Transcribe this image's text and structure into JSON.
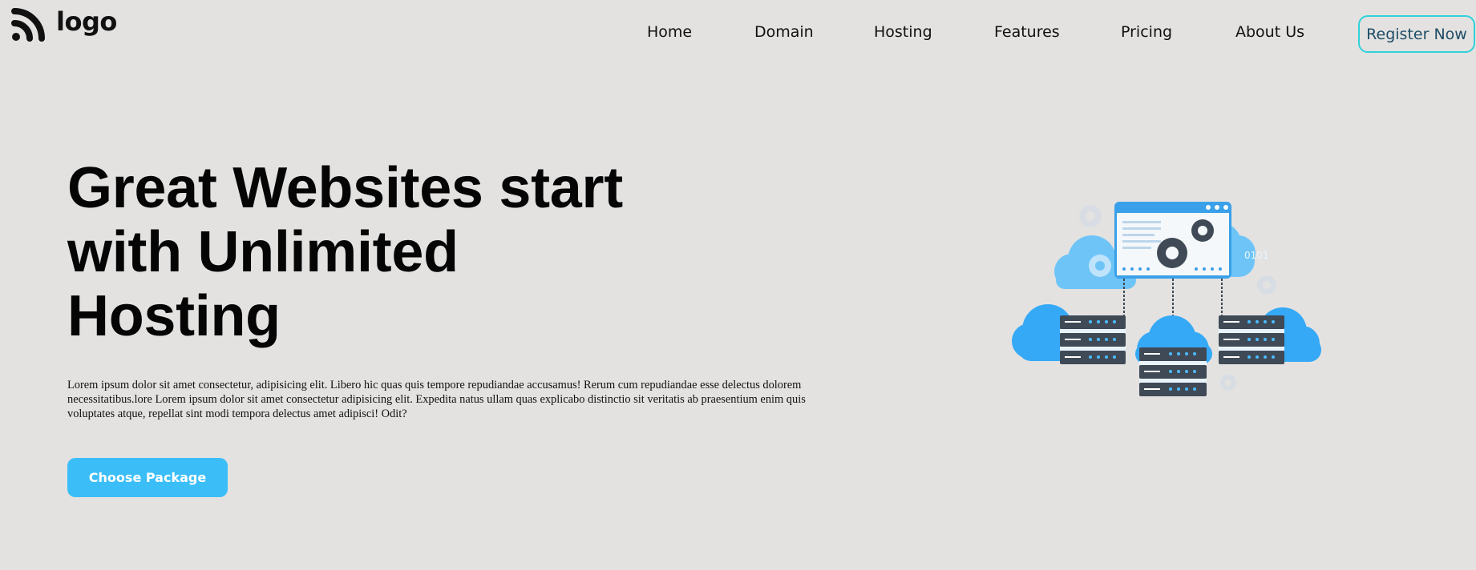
{
  "header": {
    "logo_text": "logo",
    "nav": [
      "Home",
      "Domain",
      "Hosting",
      "Features",
      "Pricing",
      "About Us"
    ],
    "register_label": "Register Now"
  },
  "hero": {
    "title": "Great Websites start with Unlimited Hosting",
    "body": "Lorem ipsum dolor sit amet consectetur, adipisicing elit. Libero hic quas quis tempore repudiandae accusamus! Rerum cum repudiandae esse delectus dolorem necessitatibus.lore Lorem ipsum dolor sit amet consectetur adipisicing elit. Expedita natus ullam quas explicabo distinctio sit veritatis ab praesentium enim quis voluptates atque, repellat sint modi tempora delectus amet adipisci! Odit?",
    "cta_label": "Choose Package",
    "illustration_text": "0101"
  },
  "colors": {
    "background": "#e3e2e1",
    "accent": "#3bbef8",
    "register_border": "#2fd1d9",
    "register_text": "#1d4c66"
  }
}
